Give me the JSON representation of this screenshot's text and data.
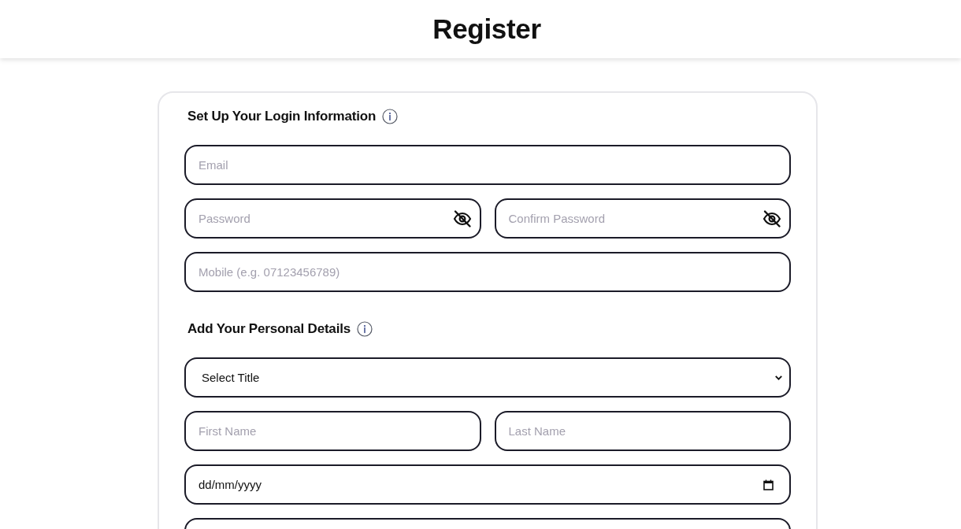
{
  "header": {
    "title": "Register"
  },
  "sections": [
    {
      "heading": "Set Up Your Login Information",
      "rows": [
        [
          {
            "kind": "text",
            "placeholder": "Email"
          }
        ],
        [
          {
            "kind": "password",
            "placeholder": "Password",
            "visible": false
          },
          {
            "kind": "password",
            "placeholder": "Confirm Password",
            "visible": false
          }
        ],
        [
          {
            "kind": "text",
            "placeholder": "Mobile (e.g. 07123456789)"
          }
        ]
      ]
    },
    {
      "heading": "Add Your Personal Details",
      "rows": [
        [
          {
            "kind": "select",
            "value": "Select Title"
          }
        ],
        [
          {
            "kind": "text",
            "placeholder": "First Name"
          },
          {
            "kind": "text",
            "placeholder": "Last Name"
          }
        ],
        [
          {
            "kind": "date",
            "value": "dd/mm/yyyy"
          }
        ],
        [
          {
            "kind": "text"
          }
        ]
      ]
    }
  ]
}
